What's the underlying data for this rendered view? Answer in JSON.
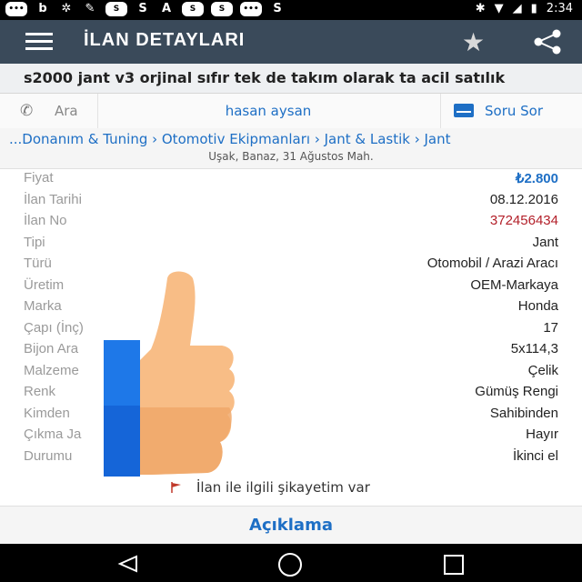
{
  "status_bar": {
    "left_icons": [
      "message-icon",
      "b-app-icon",
      "settings-app-icon",
      "wrench-icon",
      "sahibinden-icon",
      "s-app-icon",
      "a-app-icon",
      "sahibinden-icon",
      "sahibinden-icon",
      "chat-icon",
      "s-app-icon"
    ],
    "left_glyphs": [
      "•••",
      "b",
      "✲",
      "✎",
      "S",
      "S",
      "A",
      "S",
      "S",
      "•••",
      "S"
    ],
    "time": "2:34",
    "right_icons": [
      "bluetooth-icon",
      "wifi-icon",
      "signal-icon",
      "battery-icon"
    ]
  },
  "app_bar": {
    "title": "İLAN DETAYLARI"
  },
  "listing": {
    "headline": "s2000 jant v3 orjinal sıfır tek de takım olarak ta acil satılık"
  },
  "actions": {
    "call_label": "Ara",
    "seller_name": "hasan aysan",
    "ask_label": "Soru Sor"
  },
  "breadcrumb": {
    "path": "...Donanım & Tuning › Otomotiv Ekipmanları › Jant & Lastik › Jant",
    "location": "Uşak, Banaz, 31 Ağustos Mah."
  },
  "details": [
    {
      "label": "Fiyat",
      "value": "₺2.800"
    },
    {
      "label": "İlan Tarihi",
      "value": "08.12.2016"
    },
    {
      "label": "İlan No",
      "value": "372456434"
    },
    {
      "label": "Tipi",
      "value": "Jant"
    },
    {
      "label": "Türü",
      "value": "Otomobil / Arazi Aracı"
    },
    {
      "label": "Üretim",
      "value": "OEM-Markaya"
    },
    {
      "label": "Marka",
      "value": "Honda"
    },
    {
      "label": "Çapı (İnç)",
      "value": "17"
    },
    {
      "label": "Bijon Ara",
      "value": "5x114,3"
    },
    {
      "label": "Malzeme",
      "value": "Çelik"
    },
    {
      "label": "Renk",
      "value": "Gümüş Rengi"
    },
    {
      "label": "Kimden",
      "value": "Sahibinden"
    },
    {
      "label": "Çıkma Ja",
      "value": "Hayır"
    },
    {
      "label": "Durumu",
      "value": "İkinci el"
    }
  ],
  "complaint": {
    "label": "İlan ile ilgili şikayetim var"
  },
  "description": {
    "label": "Açıklama"
  },
  "colors": {
    "app_bar": "#3a4a5a",
    "link_blue": "#1e6fc5",
    "ad_no_red": "#b3202a"
  }
}
